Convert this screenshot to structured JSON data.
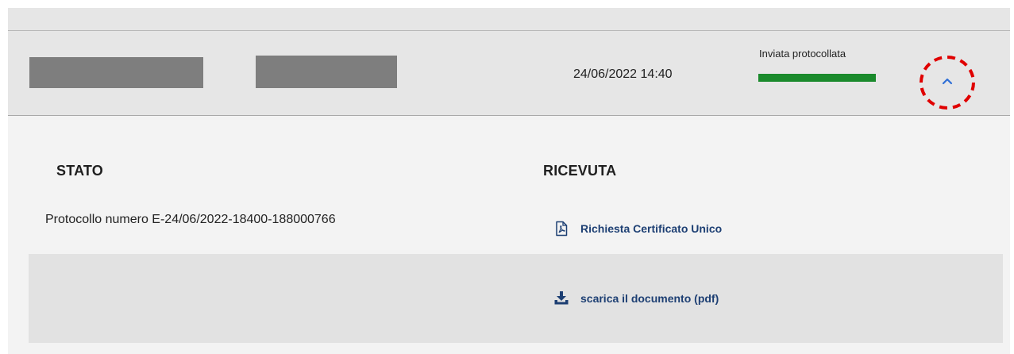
{
  "header": {
    "date": "24/06/2022 14:40",
    "status_label": "Inviata protocollata",
    "status_color": "#1a8a2c",
    "toggle_icon": "chevron-up-icon",
    "highlight_color": "#e00000"
  },
  "detail": {
    "stato": {
      "heading": "STATO",
      "protocol_text": "Protocollo numero E-24/06/2022-18400-188000766"
    },
    "ricevuta": {
      "heading": "RICEVUTA",
      "pdf_link_label": "Richiesta Certificato Unico",
      "pdf_icon": "pdf-file-icon",
      "download_label": "scarica il documento (pdf)",
      "download_icon": "download-icon"
    }
  }
}
